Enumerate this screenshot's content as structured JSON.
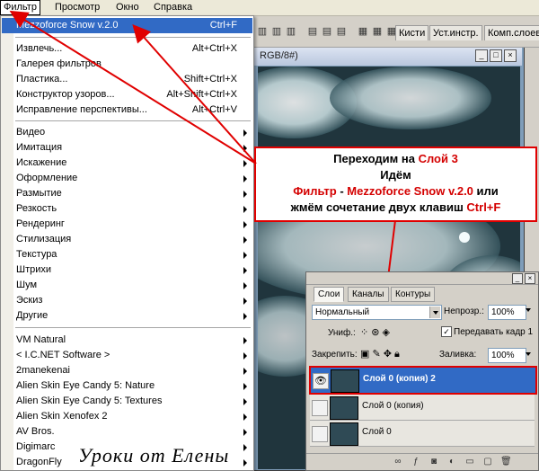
{
  "menubar": {
    "items": [
      {
        "label": "Фильтр",
        "active": true
      },
      {
        "label": "Просмотр"
      },
      {
        "label": "Окно"
      },
      {
        "label": "Справка"
      }
    ]
  },
  "toolbar": {
    "tabs": [
      "Кисти",
      "Уст.инстр.",
      "Комп.слоев"
    ]
  },
  "document": {
    "title": "RGB/8#)"
  },
  "filter_menu": {
    "items": [
      {
        "label": "Mezzoforce Snow v.2.0",
        "shortcut": "Ctrl+F",
        "highlighted": true
      },
      {
        "label": "Извлечь...",
        "shortcut": "Alt+Ctrl+X"
      },
      {
        "label": "Галерея фильтров",
        "shortcut": ""
      },
      {
        "label": "Пластика...",
        "shortcut": "Shift+Ctrl+X"
      },
      {
        "label": "Конструктор узоров...",
        "shortcut": "Alt+Shift+Ctrl+X"
      },
      {
        "label": "Исправление перспективы...",
        "shortcut": "Alt+Ctrl+V"
      },
      {
        "label": "Видео",
        "submenu": true
      },
      {
        "label": "Имитация",
        "submenu": true
      },
      {
        "label": "Искажение",
        "submenu": true
      },
      {
        "label": "Оформление",
        "submenu": true
      },
      {
        "label": "Размытие",
        "submenu": true
      },
      {
        "label": "Резкость",
        "submenu": true
      },
      {
        "label": "Рендеринг",
        "submenu": true
      },
      {
        "label": "Стилизация",
        "submenu": true
      },
      {
        "label": "Текстура",
        "submenu": true
      },
      {
        "label": "Штрихи",
        "submenu": true
      },
      {
        "label": "Шум",
        "submenu": true
      },
      {
        "label": "Эскиз",
        "submenu": true
      },
      {
        "label": "Другие",
        "submenu": true
      },
      {
        "label": "VM Natural",
        "submenu": true
      },
      {
        "label": "< I.C.NET Software >",
        "submenu": true
      },
      {
        "label": "2manekenai",
        "submenu": true
      },
      {
        "label": "Alien Skin Eye Candy 5: Nature",
        "submenu": true
      },
      {
        "label": "Alien Skin Eye Candy 5: Textures",
        "submenu": true
      },
      {
        "label": "Alien Skin Xenofex 2",
        "submenu": true
      },
      {
        "label": "AV Bros.",
        "submenu": true
      },
      {
        "label": "Digimarc",
        "submenu": true
      },
      {
        "label": "DragonFly",
        "submenu": true
      }
    ]
  },
  "note": {
    "line1_a": "Переходим на ",
    "line1_b": "Слой 3",
    "line2": "Идём",
    "line3_a": "Фильтр",
    "line3_b": " - ",
    "line3_c": "Mezzoforce Snow v.2.0",
    "line3_d": " или",
    "line4_a": "жмём сочетание двух клавиш ",
    "line4_b": "Ctrl+F"
  },
  "layers_panel": {
    "tabs": [
      "Слои",
      "Каналы",
      "Контуры"
    ],
    "blend_mode": "Нормальный",
    "opacity_label": "Непрозр.:",
    "opacity_value": "100%",
    "unify_label": "Униф.:",
    "propagate_label": "Передавать кадр 1",
    "lock_label": "Закрепить:",
    "fill_label": "Заливка:",
    "fill_value": "100%",
    "layers": [
      {
        "name": "Слой 0 (копия) 2",
        "selected": true,
        "visible": true
      },
      {
        "name": "Слой 0 (копия)",
        "selected": false,
        "visible": false
      },
      {
        "name": "Слой 0",
        "selected": false,
        "visible": false
      }
    ]
  },
  "watermark": "Уроки от Елены",
  "colors": {
    "highlight": "#316ac5",
    "annotation": "#e00000"
  }
}
